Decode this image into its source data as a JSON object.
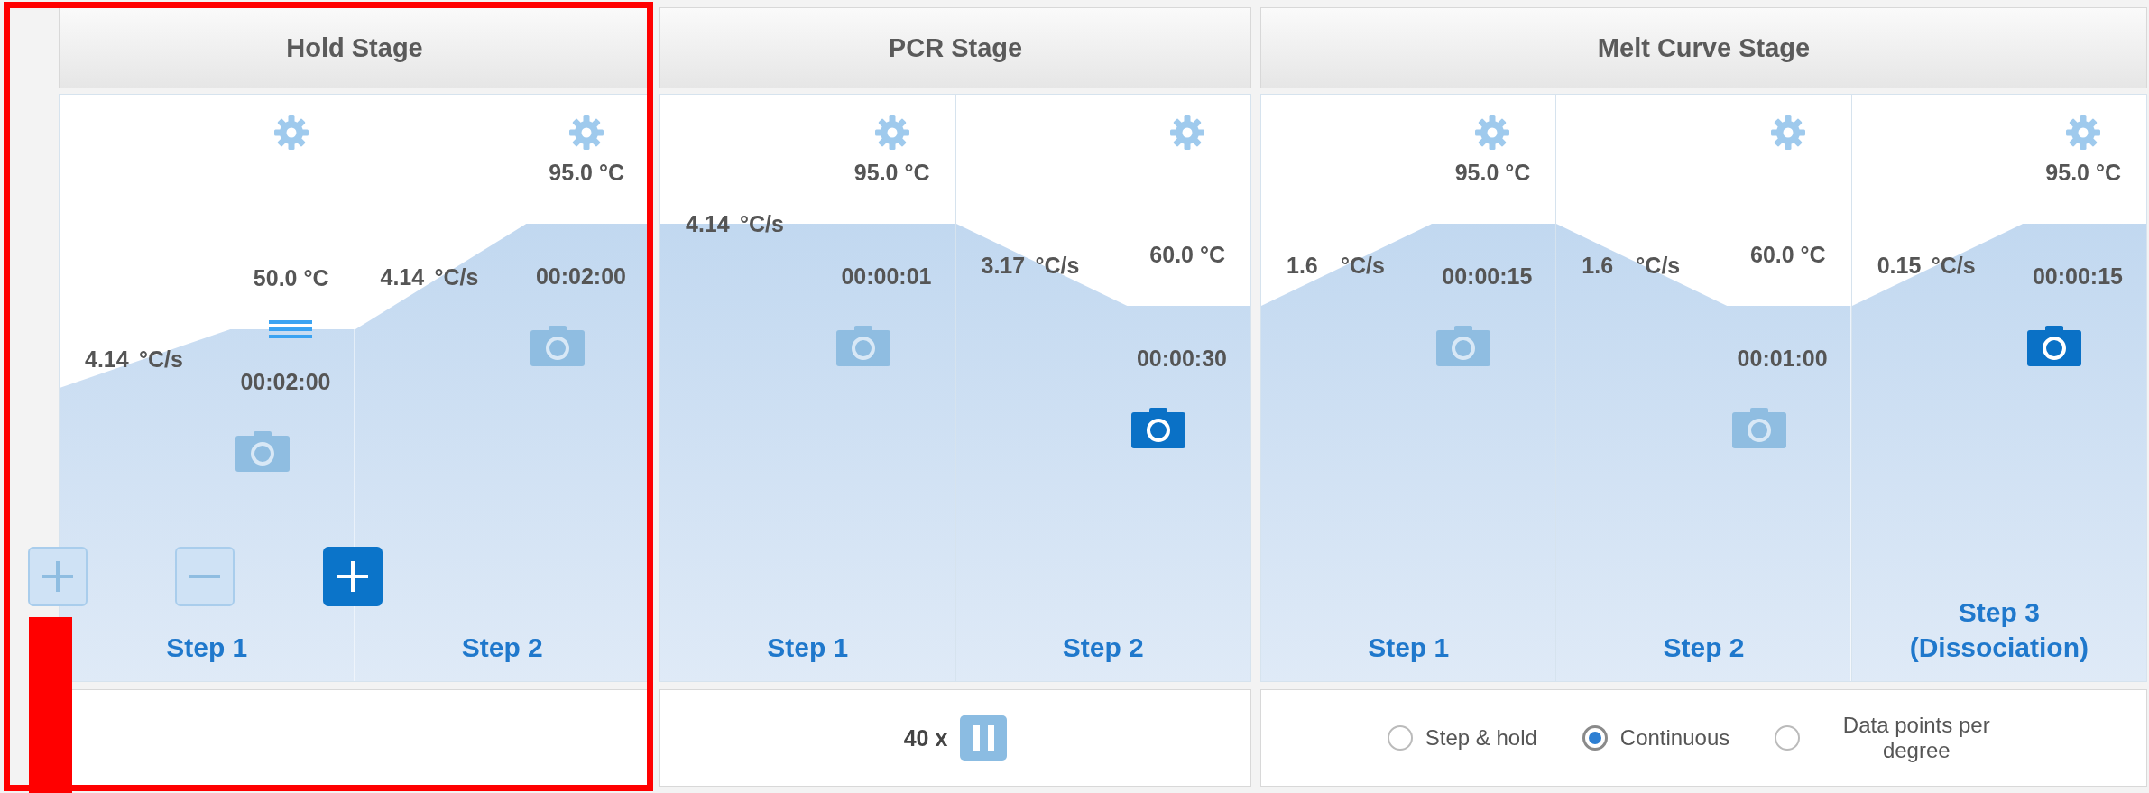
{
  "stages": [
    {
      "title": "Hold Stage",
      "steps": [
        {
          "label": "Step 1",
          "temperature": "50.0 °C",
          "rate": "4.14",
          "rate_unit": "°C/s",
          "time": "00:02:00",
          "level": 0.6,
          "collect": false,
          "handle": true
        },
        {
          "label": "Step 2",
          "temperature": "95.0 °C",
          "rate": "4.14",
          "rate_unit": "°C/s",
          "time": "00:02:00",
          "level": 0.78,
          "collect": false
        }
      ]
    },
    {
      "title": "PCR Stage",
      "steps": [
        {
          "label": "Step 1",
          "temperature": "95.0 °C",
          "rate": "4.14",
          "rate_unit": "°C/s",
          "time": "00:00:01",
          "level": 0.78,
          "collect": false
        },
        {
          "label": "Step 2",
          "temperature": "60.0 °C",
          "rate": "3.17",
          "rate_unit": "°C/s",
          "time": "00:00:30",
          "level": 0.64,
          "collect": true
        }
      ],
      "footer": {
        "kind": "cycles",
        "cycles": "40 x"
      }
    },
    {
      "title": "Melt Curve Stage",
      "steps": [
        {
          "label": "Step 1",
          "temperature": "95.0 °C",
          "rate": "1.6",
          "rate_unit": "°C/s",
          "time": "00:00:15",
          "level": 0.78,
          "collect": false
        },
        {
          "label": "Step 2",
          "temperature": "60.0 °C",
          "rate": "1.6",
          "rate_unit": "°C/s",
          "time": "00:01:00",
          "level": 0.64,
          "collect": false
        },
        {
          "label": "Step 3",
          "sublabel": "(Dissociation)",
          "temperature": "95.0 °C",
          "rate": "0.15",
          "rate_unit": "°C/s",
          "time": "00:00:15",
          "level": 0.78,
          "collect": true
        }
      ],
      "footer": {
        "kind": "radios",
        "options": [
          {
            "label": "Step & hold",
            "selected": false
          },
          {
            "label": "Continuous",
            "selected": true
          },
          {
            "label": "Data points per degree",
            "selected": false
          }
        ]
      }
    }
  ],
  "step_buttons": [
    {
      "kind": "add",
      "disabled": true
    },
    {
      "kind": "remove",
      "disabled": true
    },
    {
      "kind": "add",
      "disabled": false
    }
  ]
}
